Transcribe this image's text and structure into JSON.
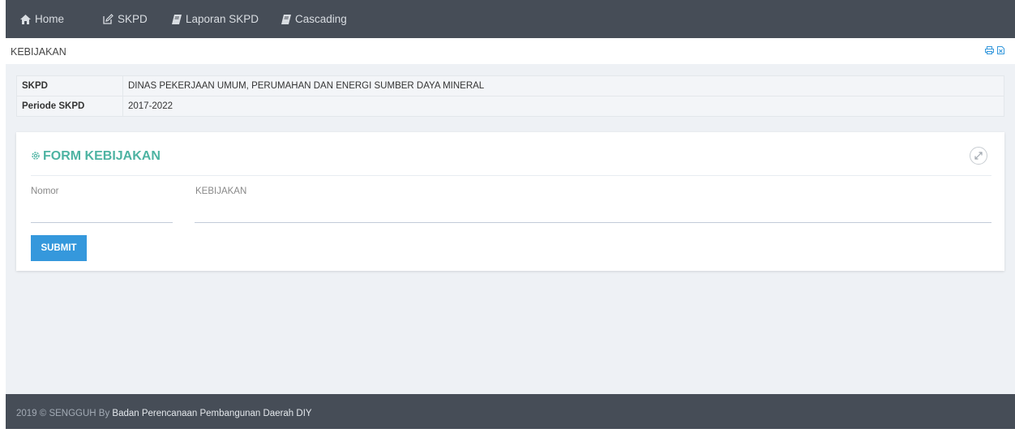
{
  "nav": {
    "items": [
      {
        "label": "Home",
        "icon": "home-icon"
      },
      {
        "label": "SKPD",
        "icon": "edit-icon"
      },
      {
        "label": "Laporan SKPD",
        "icon": "book-icon"
      },
      {
        "label": "Cascading",
        "icon": "book-icon"
      }
    ]
  },
  "page": {
    "title": "KEBIJAKAN",
    "actions": [
      {
        "icon": "print-icon"
      },
      {
        "icon": "excel-export-icon"
      }
    ]
  },
  "info": {
    "rows": [
      {
        "label": "SKPD",
        "value": "DINAS PEKERJAAN UMUM, PERUMAHAN DAN ENERGI SUMBER DAYA MINERAL"
      },
      {
        "label": "Periode SKPD",
        "value": "2017-2022"
      }
    ]
  },
  "form": {
    "title": "FORM KEBIJAKAN",
    "title_icon": "gear-icon",
    "expand_icon": "expand-icon",
    "fields": {
      "nomor_label": "Nomor",
      "nomor_value": "",
      "kebijakan_label": "KEBIJAKAN",
      "kebijakan_value": ""
    },
    "submit_label": "SUBMIT"
  },
  "footer": {
    "prefix": "2019 © SENGGUH By",
    "link": "Badan Perencanaan Pembangunan Daerah DIY"
  },
  "colors": {
    "navbar": "#464d57",
    "accent": "#4db3a2",
    "button": "#3598dc",
    "background": "#eef1f5"
  }
}
